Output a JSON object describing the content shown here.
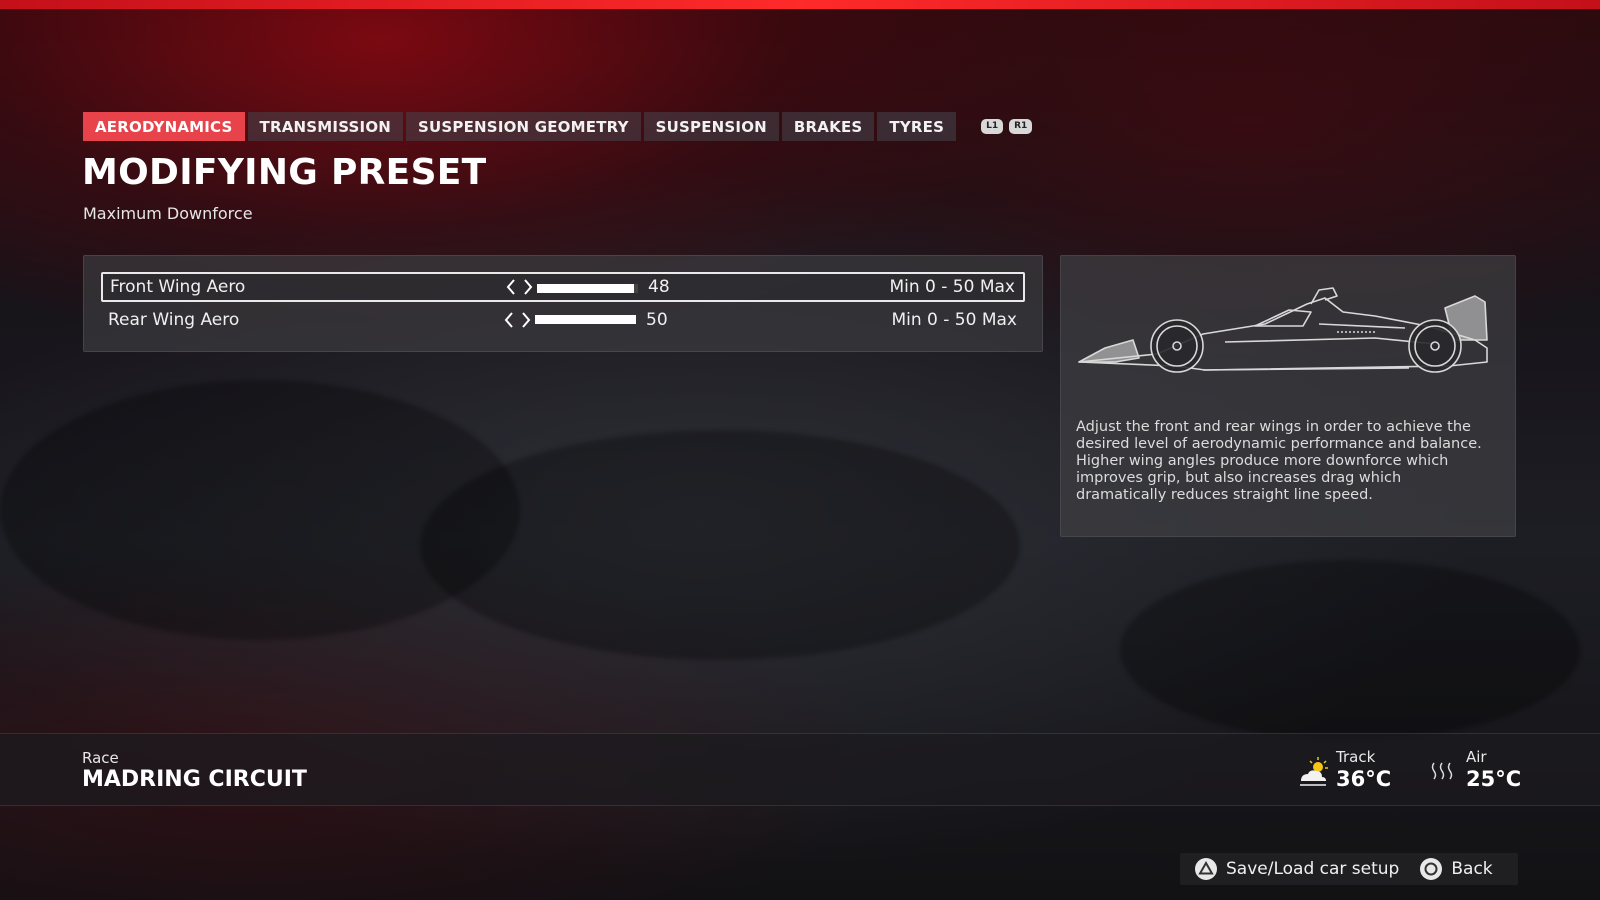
{
  "tabs": [
    {
      "label": "AERODYNAMICS",
      "active": true
    },
    {
      "label": "TRANSMISSION",
      "active": false
    },
    {
      "label": "SUSPENSION GEOMETRY",
      "active": false
    },
    {
      "label": "SUSPENSION",
      "active": false
    },
    {
      "label": "BRAKES",
      "active": false
    },
    {
      "label": "TYRES",
      "active": false
    }
  ],
  "shoulder_buttons": {
    "left": "L1",
    "right": "R1"
  },
  "page": {
    "title": "MODIFYING PRESET",
    "subtitle": "Maximum Downforce"
  },
  "settings": [
    {
      "label": "Front Wing Aero",
      "value": "48",
      "fill_fraction": 0.96,
      "range": "Min 0 - 50 Max",
      "selected": true
    },
    {
      "label": "Rear Wing Aero",
      "value": "50",
      "fill_fraction": 1.0,
      "range": "Min 0 - 50 Max",
      "selected": false
    }
  ],
  "info": {
    "paragraph_1": "Adjust the front and rear wings in order to achieve the desired level of aerodynamic performance and balance.",
    "paragraph_2": "Higher wing angles produce more downforce which improves grip, but also increases drag which dramatically reduces straight line speed."
  },
  "session": {
    "type": "Race",
    "circuit": "MADRING CIRCUIT"
  },
  "weather": {
    "track": {
      "label": "Track",
      "value": "36°C",
      "icon": "partly-sunny-icon"
    },
    "air": {
      "label": "Air",
      "value": "25°C",
      "icon": "heat-waves-icon"
    }
  },
  "prompts": {
    "save_load": "Save/Load car setup",
    "back": "Back"
  },
  "colors": {
    "accent": "#e8434a",
    "top_strip": "#e81c22"
  }
}
